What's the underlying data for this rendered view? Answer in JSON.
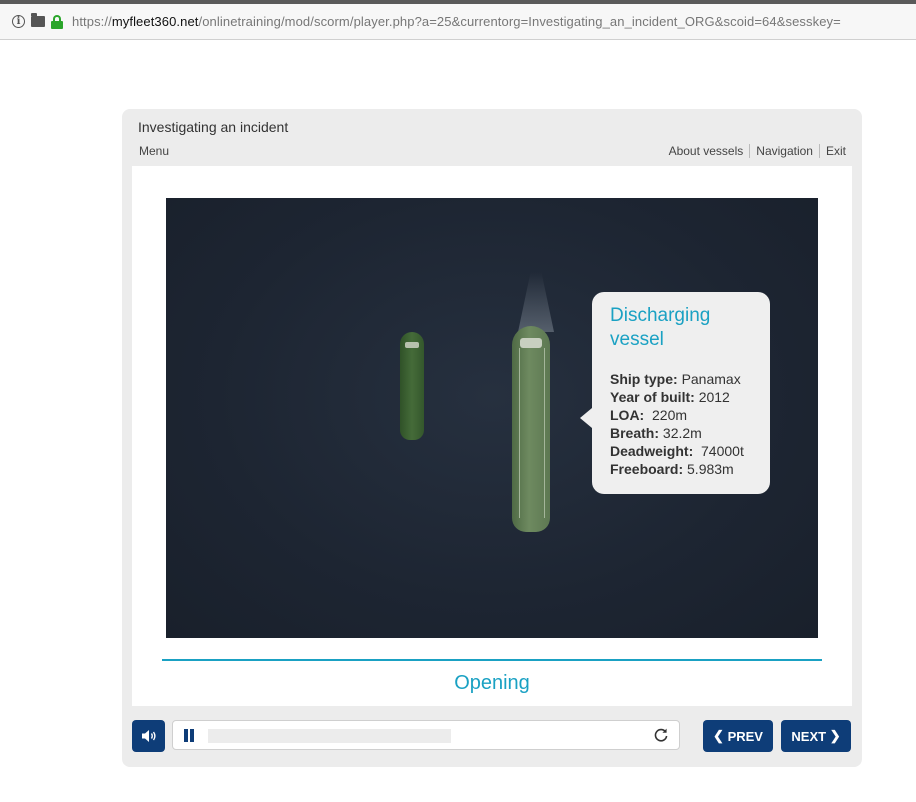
{
  "browser": {
    "url_prefix": "https://",
    "url_domain": "myfleet360.net",
    "url_path": "/onlinetraining/mod/scorm/player.php?a=25&currentorg=Investigating_an_incident_ORG&scoid=64&sesskey="
  },
  "player": {
    "title": "Investigating an incident",
    "menu_label": "Menu",
    "nav": [
      "About vessels",
      "Navigation",
      "Exit"
    ]
  },
  "callout": {
    "title_line1": "Discharging",
    "title_line2": "vessel",
    "rows": [
      {
        "label": "Ship type:",
        "value": "Panamax"
      },
      {
        "label": "Year of built:",
        "value": "2012"
      },
      {
        "label": "LOA:",
        "value": "220m"
      },
      {
        "label": "Breath:",
        "value": "32.2m"
      },
      {
        "label": "Deadweight:",
        "value": "74000t"
      },
      {
        "label": "Freeboard:",
        "value": "5.983m"
      }
    ]
  },
  "section_title": "Opening",
  "controls": {
    "prev_label": "PREV",
    "next_label": "NEXT",
    "progress_fraction": 0.0
  },
  "colors": {
    "accent": "#1aa1c3",
    "button": "#0e3d78"
  },
  "icons": [
    "info-icon",
    "folder-icon",
    "lock-icon",
    "volume-icon",
    "pause-icon",
    "replay-icon",
    "chevron-left-icon",
    "chevron-right-icon"
  ]
}
